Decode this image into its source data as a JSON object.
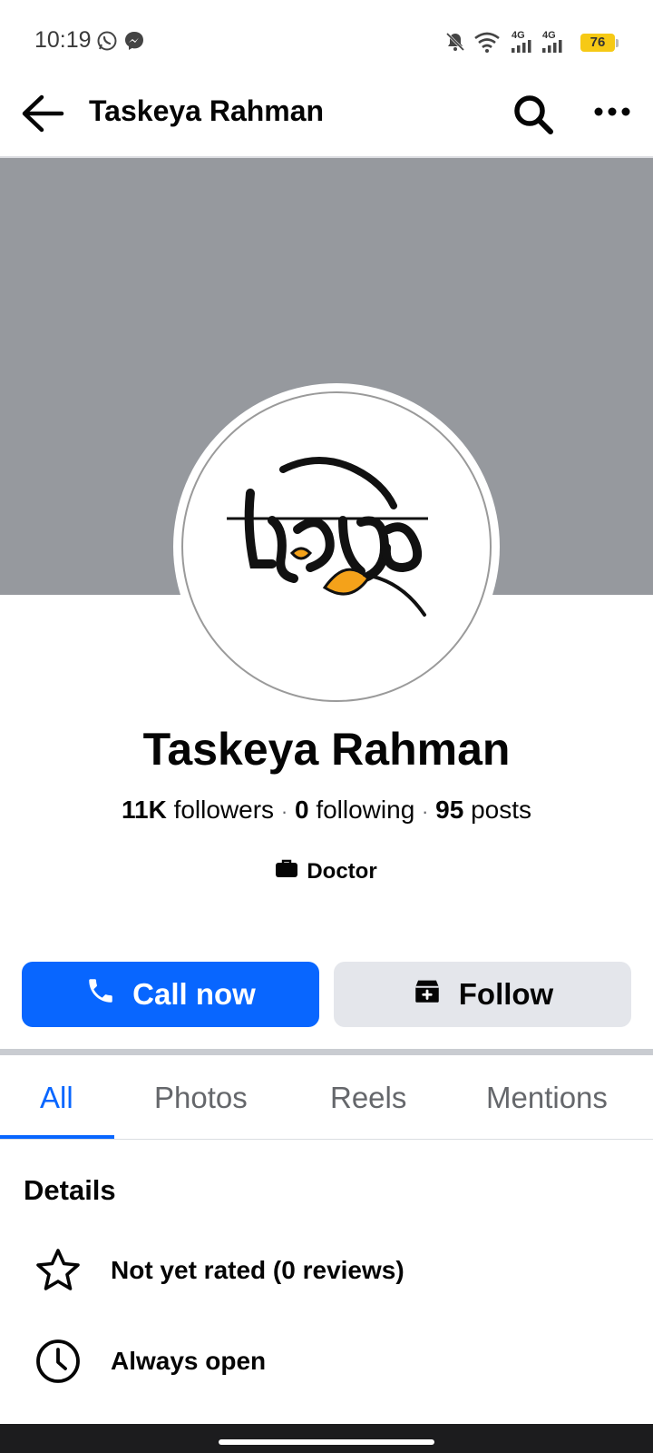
{
  "status_bar": {
    "time": "10:19",
    "battery": "76",
    "network_1": "4G",
    "network_2": "4G",
    "icons": [
      "whatsapp-icon",
      "messenger-icon",
      "mute-icon",
      "wifi-icon",
      "signal-icon",
      "signal-icon",
      "battery-icon"
    ]
  },
  "header": {
    "title": "Taskeya Rahman",
    "icons": [
      "back-arrow-icon",
      "search-icon",
      "more-icon"
    ]
  },
  "profile": {
    "name": "Taskeya Rahman",
    "followers_count": "11K",
    "followers_label": "followers",
    "following_count": "0",
    "following_label": "following",
    "posts_count": "95",
    "posts_label": "posts",
    "separator": "·",
    "category": "Doctor",
    "category_icon": "briefcase-icon",
    "avatar_logo": "chirkut-logo",
    "avatar_accent": "#f4a21a"
  },
  "actions": {
    "call_label": "Call now",
    "call_icon": "phone-icon",
    "follow_label": "Follow",
    "follow_icon": "follow-page-icon"
  },
  "tabs": [
    {
      "label": "All",
      "active": true
    },
    {
      "label": "Photos",
      "active": false
    },
    {
      "label": "Reels",
      "active": false
    },
    {
      "label": "Mentions",
      "active": false
    }
  ],
  "details": {
    "title": "Details",
    "items": [
      {
        "icon": "star-icon",
        "text": "Not yet rated (0 reviews)"
      },
      {
        "icon": "clock-icon",
        "text": "Always open"
      }
    ]
  },
  "colors": {
    "accent": "#0866ff",
    "cover": "#96999e",
    "secondary_button": "#e4e6eb"
  }
}
